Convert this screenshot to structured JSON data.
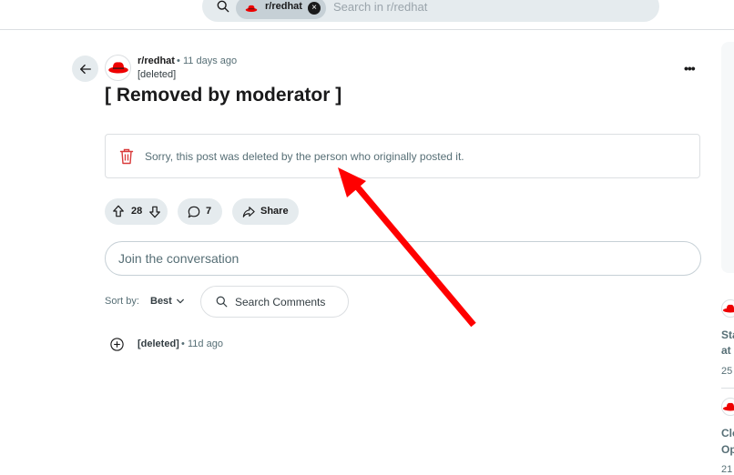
{
  "search": {
    "subreddit_chip": "r/redhat",
    "placeholder": "Search in r/redhat",
    "chip_clear": "×"
  },
  "post": {
    "subreddit": "r/redhat",
    "separator": "•",
    "age": "11 days ago",
    "author": "[deleted]",
    "title": "[ Removed by moderator ]",
    "deleted_message": "Sorry, this post was deleted by the person who originally posted it.",
    "overflow": "•••",
    "votes": "28",
    "comments": "7",
    "share_label": "Share"
  },
  "comments_section": {
    "join_placeholder": "Join the conversation",
    "sort_label": "Sort by:",
    "sort_value": "Best",
    "search_label": "Search Comments",
    "first_comment": {
      "author": "[deleted]",
      "separator": "•",
      "age": "11d ago"
    }
  },
  "right_rail": {
    "item1_line1": "Sta",
    "item1_line2": "at",
    "item1_count": "25",
    "item2_line1": "Clo",
    "item2_line2": "Op",
    "item2_count": "21"
  },
  "colors": {
    "annotation_arrow": "#ff0000",
    "brand_red": "#ee0000",
    "trash_red": "#d93a3a"
  },
  "icons": [
    "search-icon",
    "redhat-logo-icon",
    "close-icon",
    "back-arrow-icon",
    "overflow-menu-icon",
    "trash-icon",
    "upvote-icon",
    "downvote-icon",
    "comment-icon",
    "share-icon",
    "chevron-down-icon",
    "expand-plus-icon"
  ]
}
